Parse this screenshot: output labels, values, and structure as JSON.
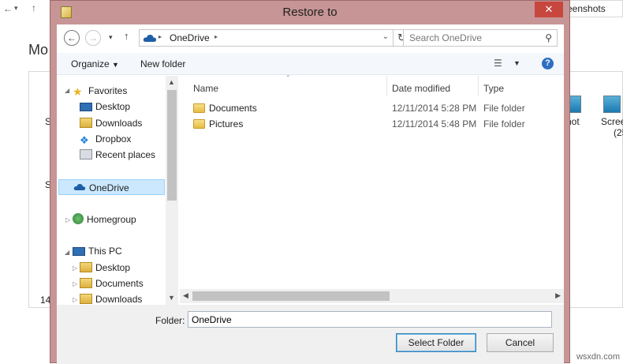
{
  "background_window": {
    "address_fragment": "eenshots",
    "heading_fragment": "Mo",
    "left_fragments": [
      "S",
      "S"
    ],
    "count_fragment": "14",
    "right_item_labels": [
      "hot",
      "Scree",
      "(25"
    ]
  },
  "dialog": {
    "title": "Restore to",
    "close_symbol": "✕",
    "address": {
      "location": "OneDrive",
      "separator": "▸"
    },
    "search_placeholder": "Search OneDrive",
    "toolbar": {
      "organize_label": "Organize",
      "new_folder_label": "New folder"
    },
    "nav_pane": {
      "favorites": {
        "label": "Favorites",
        "items": [
          "Desktop",
          "Downloads",
          "Dropbox",
          "Recent places"
        ]
      },
      "onedrive_label": "OneDrive",
      "homegroup_label": "Homegroup",
      "this_pc": {
        "label": "This PC",
        "items": [
          "Desktop",
          "Documents",
          "Downloads"
        ]
      }
    },
    "columns": {
      "name": "Name",
      "date_modified": "Date modified",
      "type": "Type"
    },
    "files": [
      {
        "name": "Documents",
        "date_modified": "12/11/2014 5:28 PM",
        "type": "File folder"
      },
      {
        "name": "Pictures",
        "date_modified": "12/11/2014 5:48 PM",
        "type": "File folder"
      }
    ],
    "folder_field": {
      "label": "Folder:",
      "value": "OneDrive"
    },
    "buttons": {
      "select_folder": "Select Folder",
      "cancel": "Cancel"
    }
  },
  "watermark": "wsxdn.com",
  "colors": {
    "frame": "#c79595",
    "selection": "#cce8ff",
    "close_button": "#c7463e",
    "onedrive_blue": "#1f5fa8"
  }
}
